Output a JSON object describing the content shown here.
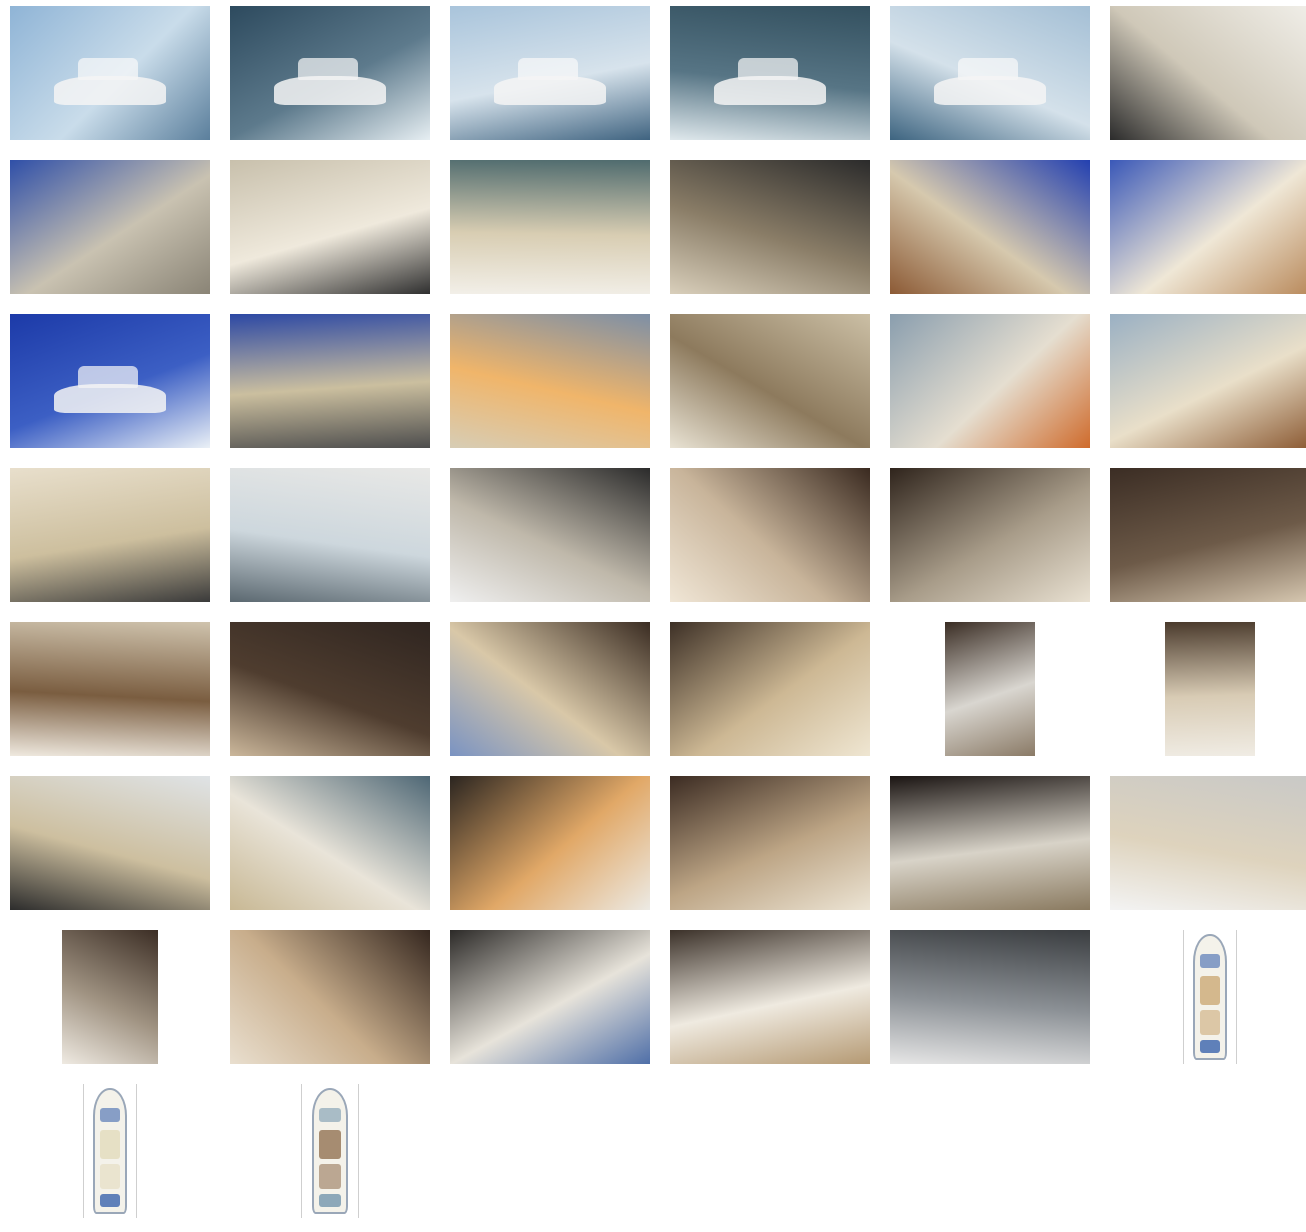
{
  "gallery": {
    "images": [
      {
        "icon": "yacht-exterior-photo",
        "colors": [
          "#8fb4d6",
          "#c9dcea",
          "#5b7f9c"
        ],
        "hull": true
      },
      {
        "icon": "yacht-exterior-photo",
        "colors": [
          "#2d4a5e",
          "#5d7a8c",
          "#e6eef2"
        ],
        "hull": true
      },
      {
        "icon": "yacht-exterior-photo",
        "colors": [
          "#a9c4db",
          "#d7e3ec",
          "#3f6380"
        ],
        "hull": true
      },
      {
        "icon": "yacht-exterior-photo",
        "colors": [
          "#33505f",
          "#577585",
          "#dfe8ec"
        ],
        "hull": true
      },
      {
        "icon": "yacht-exterior-photo",
        "colors": [
          "#a4bfd5",
          "#d4e1ea",
          "#3d6480"
        ],
        "hull": true
      },
      {
        "icon": "helm-station-photo",
        "colors": [
          "#f0eee8",
          "#cfc8b8",
          "#2b2b2b"
        ],
        "hull": false
      },
      {
        "icon": "cockpit-photo",
        "colors": [
          "#2f4fa8",
          "#c9c2b1",
          "#8a8476"
        ],
        "hull": false
      },
      {
        "icon": "helm-station-photo",
        "colors": [
          "#c8c0ac",
          "#efe9dc",
          "#2f2f2f"
        ],
        "hull": false
      },
      {
        "icon": "bow-sunpad-photo",
        "colors": [
          "#4f6b6e",
          "#d8cdb2",
          "#f2efe8"
        ],
        "hull": false
      },
      {
        "icon": "lower-helm-photo",
        "colors": [
          "#2b2b2b",
          "#8a7d67",
          "#d9cfbb"
        ],
        "hull": false
      },
      {
        "icon": "aft-deck-photo",
        "colors": [
          "#2340b0",
          "#d6c9ae",
          "#8c5a35"
        ],
        "hull": false
      },
      {
        "icon": "flybridge-photo",
        "colors": [
          "#3a58b8",
          "#efe7d6",
          "#b98a5c"
        ],
        "hull": false
      },
      {
        "icon": "yacht-exterior-photo",
        "colors": [
          "#1c3aa8",
          "#3c5fc4",
          "#eaf0f6"
        ],
        "hull": true
      },
      {
        "icon": "helm-station-photo",
        "colors": [
          "#2c48a4",
          "#cbbf9f",
          "#4d4d4d"
        ],
        "hull": false
      },
      {
        "icon": "bow-sunset-photo",
        "colors": [
          "#7d8fa6",
          "#f0b56a",
          "#d7cdb5"
        ],
        "hull": false
      },
      {
        "icon": "flybridge-photo",
        "colors": [
          "#cbbfa5",
          "#8d7a5d",
          "#e9e3d4"
        ],
        "hull": false
      },
      {
        "icon": "grill-station-photo",
        "colors": [
          "#8a9eae",
          "#e5ded0",
          "#cf6b2c"
        ],
        "hull": false
      },
      {
        "icon": "flybridge-photo",
        "colors": [
          "#9ab0c3",
          "#e9dfc9",
          "#8c5b34"
        ],
        "hull": false
      },
      {
        "icon": "helm-seating-photo",
        "colors": [
          "#e8dfcc",
          "#cdbf9e",
          "#3a3a3a"
        ],
        "hull": false
      },
      {
        "icon": "hardtop-photo",
        "colors": [
          "#e8e8e6",
          "#cdd7dd",
          "#5b6870"
        ],
        "hull": false
      },
      {
        "icon": "salon-photo",
        "colors": [
          "#2b2b2b",
          "#bfb8aa",
          "#efefef"
        ],
        "hull": false
      },
      {
        "icon": "galley-photo",
        "colors": [
          "#3a2a20",
          "#c8b49a",
          "#f0e6d6"
        ],
        "hull": false
      },
      {
        "icon": "galley-photo",
        "colors": [
          "#2f241c",
          "#a89c89",
          "#e9e1d2"
        ],
        "hull": false
      },
      {
        "icon": "master-cabin-photo",
        "colors": [
          "#3b2d24",
          "#6d5a48",
          "#d6c7b0"
        ],
        "hull": false
      },
      {
        "icon": "head-photo",
        "colors": [
          "#cfc3ad",
          "#7a5d40",
          "#efe9df"
        ],
        "hull": false
      },
      {
        "icon": "master-cabin-photo",
        "colors": [
          "#2f2520",
          "#4f3d2f",
          "#cbb79b"
        ],
        "hull": false
      },
      {
        "icon": "vip-cabin-photo",
        "colors": [
          "#3a2c22",
          "#d9c8a8",
          "#7a93c2"
        ],
        "hull": false
      },
      {
        "icon": "guest-cabin-photo",
        "colors": [
          "#3d3026",
          "#cdb894",
          "#efe6d2"
        ],
        "hull": false
      },
      {
        "icon": "washer-dryer-photo",
        "colors": [
          "#3a2d24",
          "#d9d6d0",
          "#8a7a66"
        ],
        "hull": false,
        "narrow": true
      },
      {
        "icon": "shower-photo",
        "colors": [
          "#4a3a2c",
          "#d8cbb4",
          "#f0ece4"
        ],
        "hull": false,
        "narrow": true
      },
      {
        "icon": "bow-seating-photo",
        "colors": [
          "#dfe3e6",
          "#cdbf9f",
          "#2c2c2c"
        ],
        "hull": false
      },
      {
        "icon": "bow-sunpad-photo",
        "colors": [
          "#4e6775",
          "#e9e4d9",
          "#c8b894"
        ],
        "hull": false
      },
      {
        "icon": "aft-deck-photo",
        "colors": [
          "#2b2520",
          "#e1a867",
          "#eceae4"
        ],
        "hull": false
      },
      {
        "icon": "guest-cabin-photo",
        "colors": [
          "#3b2b22",
          "#bda585",
          "#ece4d4"
        ],
        "hull": false
      },
      {
        "icon": "head-photo",
        "colors": [
          "#1a1412",
          "#d8d3c8",
          "#8a7a60"
        ],
        "hull": false
      },
      {
        "icon": "flybridge-seating-photo",
        "colors": [
          "#c9c9c7",
          "#ded3bd",
          "#f3f3f3"
        ],
        "hull": false
      },
      {
        "icon": "stairway-photo",
        "colors": [
          "#3c2e25",
          "#a09382",
          "#efeae2"
        ],
        "hull": false,
        "narrow": true
      },
      {
        "icon": "galley-photo",
        "colors": [
          "#35271f",
          "#c8ad8b",
          "#e9dfcf"
        ],
        "hull": false
      },
      {
        "icon": "salon-photo",
        "colors": [
          "#2c2a28",
          "#e7e3da",
          "#4f6fa8"
        ],
        "hull": false
      },
      {
        "icon": "salon-photo",
        "colors": [
          "#3b3129",
          "#efeae0",
          "#b59a74"
        ],
        "hull": false
      },
      {
        "icon": "engine-room-photo",
        "colors": [
          "#3a3d40",
          "#8c9196",
          "#e6e6e6"
        ],
        "hull": false
      },
      {
        "icon": "deck-plan-drawing",
        "colors": [
          "#ffffff",
          "#c9a46d",
          "#2d5aa8"
        ],
        "plan": true
      },
      {
        "icon": "deck-plan-drawing",
        "colors": [
          "#ffffff",
          "#e2d9b8",
          "#2d5aa8"
        ],
        "plan": true
      },
      {
        "icon": "deck-plan-drawing",
        "colors": [
          "#ffffff",
          "#8c6a48",
          "#6b8fa8"
        ],
        "plan": true
      }
    ]
  }
}
